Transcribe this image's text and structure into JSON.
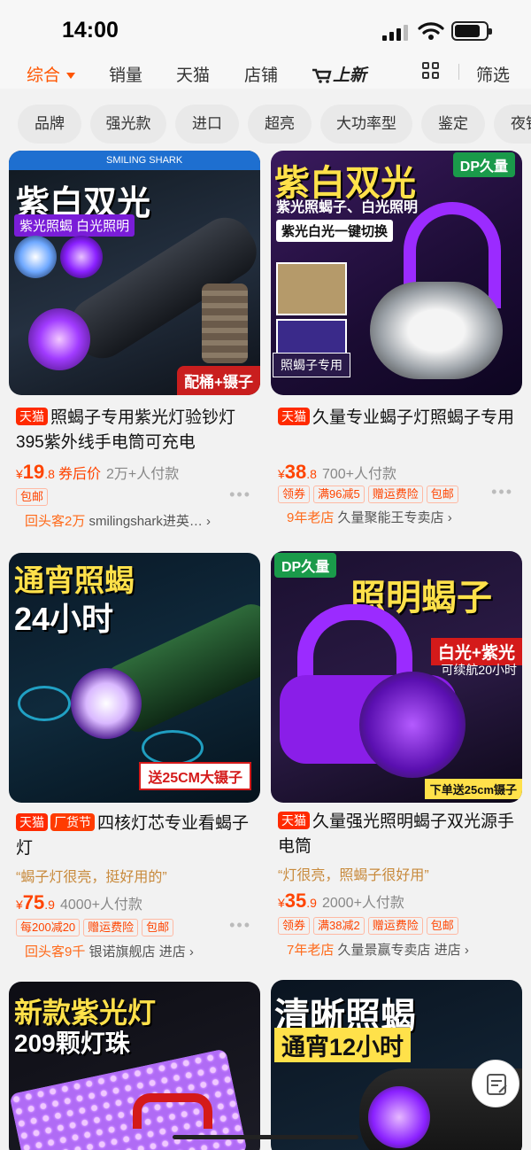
{
  "status": {
    "time": "14:00"
  },
  "sort_bar": {
    "items": [
      "综合",
      "销量",
      "天猫",
      "店铺"
    ],
    "new_label": "上新",
    "filter_label": "筛选"
  },
  "filter_chips": [
    "品牌",
    "强光款",
    "进口",
    "超亮",
    "大功率型",
    "鉴定",
    "夜钓"
  ],
  "products": [
    {
      "image": {
        "brand": "SMILING SHARK",
        "headline": "紫白双光",
        "sub": "紫光照蝎 白光照明",
        "corner": "配桶+镊子"
      },
      "tags": [
        "天猫"
      ],
      "title": "照蝎子专用紫光灯验钞灯395紫外线手电筒可充电",
      "currency": "¥",
      "price_int": "19",
      "price_dec": ".8",
      "coupon_label": "券后价",
      "sold": "2万+人付款",
      "badges": [
        "包邮"
      ],
      "store_prefix": "回头客2万",
      "store_name": "smilingshark进英…"
    },
    {
      "image": {
        "brand": "DP久量",
        "headline": "紫白双光",
        "sub": "紫光照蝎子、白光照明",
        "sub2": "紫光白光一键切换",
        "corner": "照蝎子专用"
      },
      "tags": [
        "天猫"
      ],
      "title": "久量专业蝎子灯照蝎子专用",
      "currency": "¥",
      "price_int": "38",
      "price_dec": ".8",
      "sold": "700+人付款",
      "badges": [
        "领券",
        "满96减5",
        "赠运费险",
        "包邮"
      ],
      "store_prefix": "9年老店",
      "store_name": "久量聚能王专卖店"
    },
    {
      "image": {
        "headline": "通宵照蝎",
        "headline2": "24小时",
        "corner": "送25CM大镊子"
      },
      "tags": [
        "天猫",
        "厂货节"
      ],
      "title": "四核灯芯专业看蝎子灯",
      "quote": "“蝎子灯很亮，挺好用的”",
      "currency": "¥",
      "price_int": "75",
      "price_dec": ".9",
      "sold": "4000+人付款",
      "badges": [
        "每200减20",
        "赠运费险",
        "包邮"
      ],
      "store_prefix": "回头客9千",
      "store_name": "银诺旗舰店",
      "store_action": "进店"
    },
    {
      "image": {
        "brand": "DP久量",
        "headline": "照明蝎子",
        "sub": "白光+紫光",
        "sub2": "可续航20小时",
        "corner": "下单送25cm镊子"
      },
      "tags": [
        "天猫"
      ],
      "title": "久量强光照明蝎子双光源手电筒",
      "quote": "“灯很亮，照蝎子很好用”",
      "currency": "¥",
      "price_int": "35",
      "price_dec": ".9",
      "sold": "2000+人付款",
      "badges": [
        "领券",
        "满38减2",
        "赠运费险",
        "包邮"
      ],
      "store_prefix": "7年老店",
      "store_name": "久量景赢专卖店",
      "store_action": "进店"
    },
    {
      "image": {
        "headline": "新款紫光灯",
        "headline2": "209颗灯珠"
      }
    },
    {
      "image": {
        "headline": "清晰照蝎",
        "headline2": "通宵12小时"
      }
    }
  ],
  "colors": {
    "accent": "#ff5500",
    "tmall": "#ff2a00",
    "purple": "#9b2bff"
  }
}
